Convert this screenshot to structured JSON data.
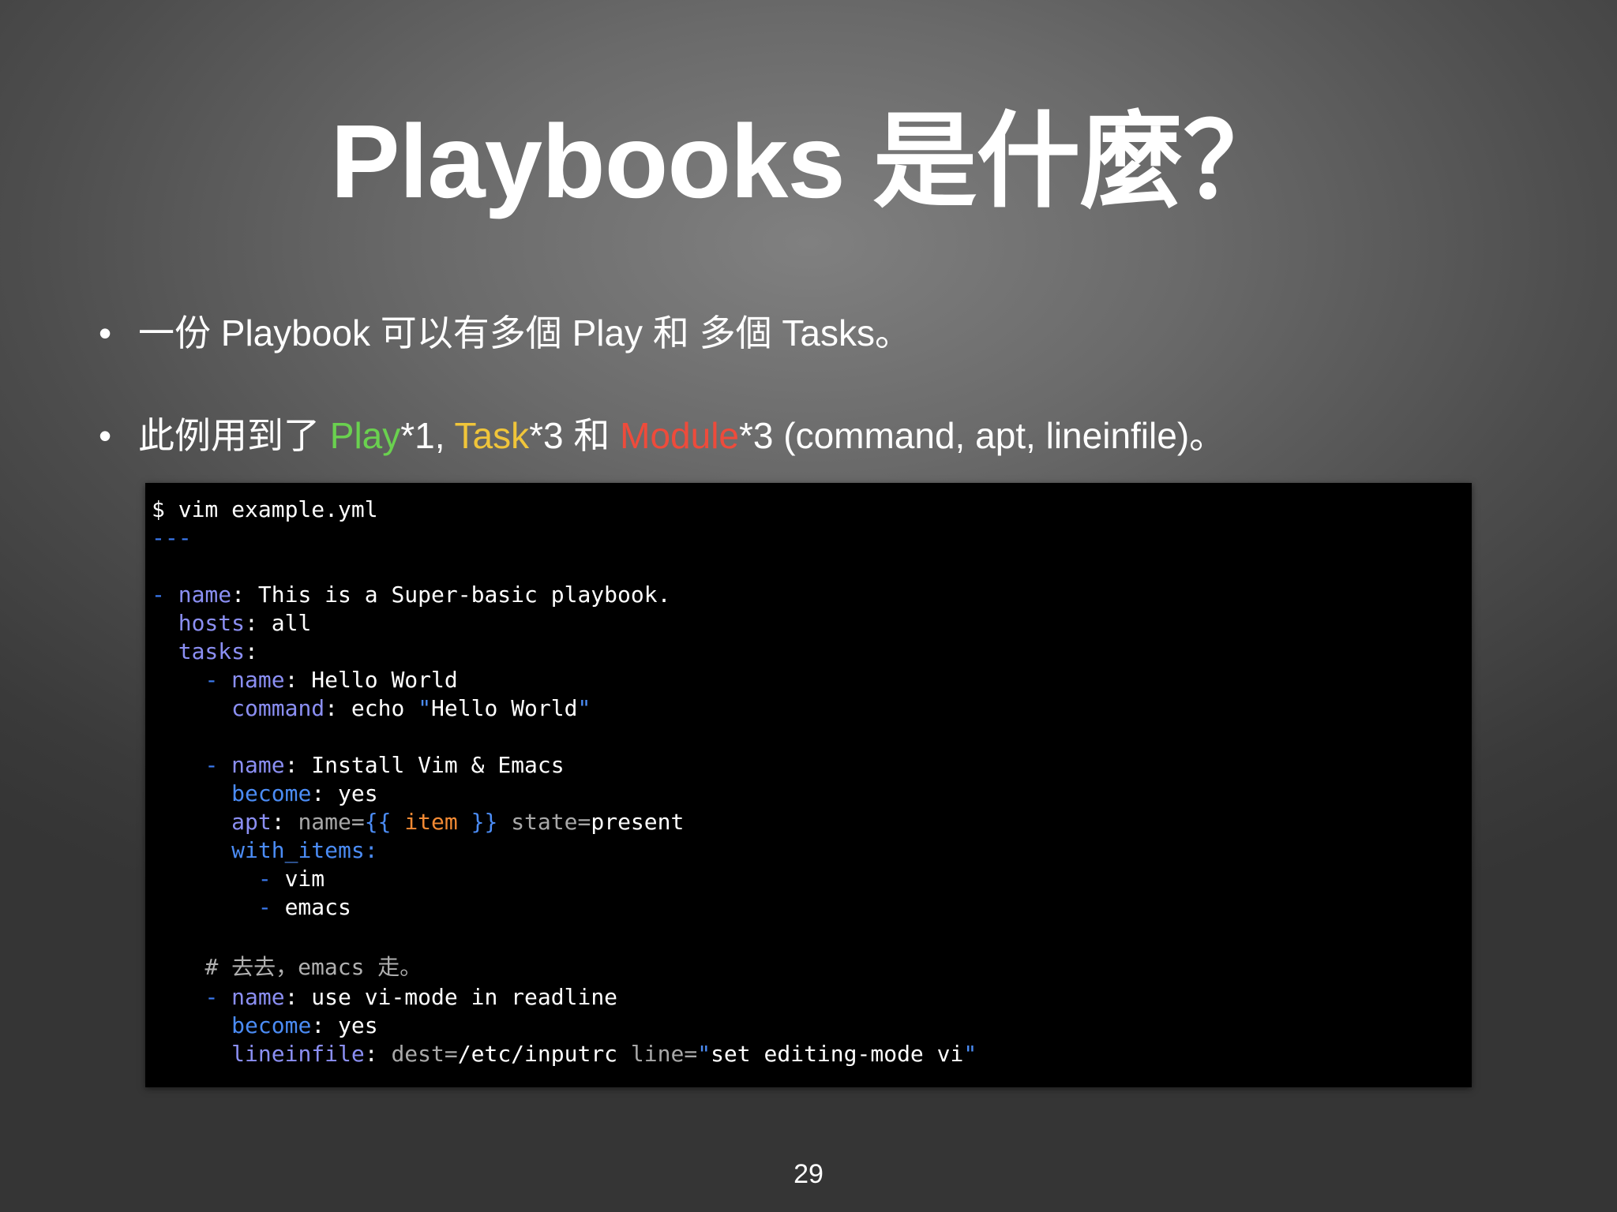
{
  "slide": {
    "title": "Playbooks 是什麼？",
    "page_number": "29"
  },
  "bullets": {
    "symbol": "•",
    "b1": "一份 Playbook 可以有多個 Play 和 多個 Tasks。",
    "b2": {
      "prefix": "此例用到了 ",
      "play": "Play",
      "play_count": "*1, ",
      "task": "Task",
      "task_count": "*3 和 ",
      "module": "Module",
      "module_count": "*3 (command, apt, lineinfile)。"
    }
  },
  "code": {
    "l1": "$ vim example.yml",
    "l2": "---",
    "l4_dash": "- ",
    "l4_key": "name",
    "l4_val": ": This is a Super-basic playbook.",
    "l5_key": "hosts",
    "l5_val": ": all",
    "l6_key": "tasks",
    "l6_val": ":",
    "l7_dash": "- ",
    "l7_key": "name",
    "l7_val": ": Hello World",
    "l8_key": "command",
    "l8_val": ": echo ",
    "l8_q1": "\"",
    "l8_str": "Hello World",
    "l8_q2": "\"",
    "l10_dash": "- ",
    "l10_key": "name",
    "l10_val": ": Install Vim & Emacs",
    "l11_key": "become",
    "l11_val": ": yes",
    "l12_key": "apt",
    "l12_colon": ": ",
    "l12_a1": "name=",
    "l12_b1": "{{ ",
    "l12_item": "item",
    "l12_b2": " }}",
    "l12_a2": " state=",
    "l12_val": "present",
    "l13_key": "with_items:",
    "l14_dash": "- ",
    "l14_val": "vim",
    "l15_dash": "- ",
    "l15_val": "emacs",
    "l17": "# 去去，emacs 走。",
    "l18_dash": "- ",
    "l18_key": "name",
    "l18_val": ": use vi-mode in readline",
    "l19_key": "become",
    "l19_val": ": yes",
    "l20_key": "lineinfile",
    "l20_colon": ": ",
    "l20_a1": "dest=",
    "l20_v1": "/etc/inputrc ",
    "l20_a2": "line=",
    "l20_q1": "\"",
    "l20_str": "set editing-mode vi",
    "l20_q2": "\""
  }
}
